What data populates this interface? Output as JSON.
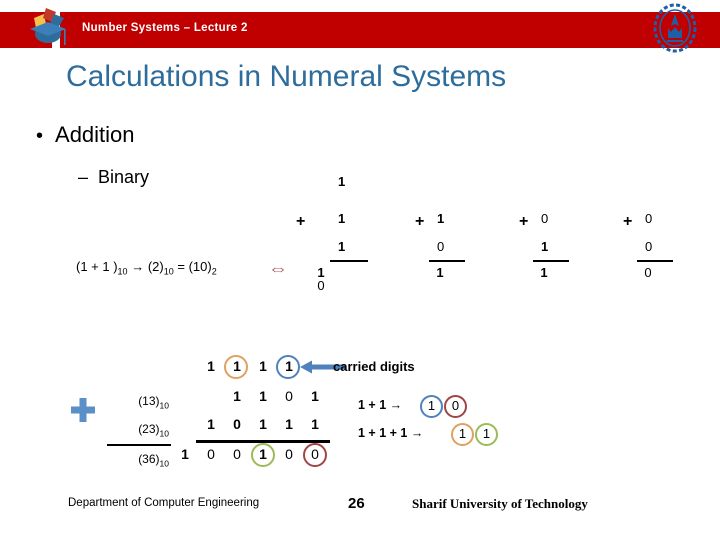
{
  "header": {
    "title": "Number Systems – Lecture 2",
    "bar_color": "#C00000",
    "left_logo": "graduation-cap-logo",
    "right_logo": "sharif-university-seal"
  },
  "slide": {
    "title": "Calculations in Numeral Systems",
    "title_color": "#2E6D9B",
    "bullet_level1": "Addition",
    "bullet_level1_marker": "•",
    "bullet_level2": "Binary",
    "bullet_level2_marker": "–"
  },
  "mini_sums": [
    {
      "carry": "1",
      "plus": "+",
      "operand_a": "1",
      "operand_b": "1",
      "result_digits": [
        "1",
        "0"
      ]
    },
    {
      "carry": "",
      "plus": "+",
      "operand_a": "1",
      "operand_b": "0",
      "result_digits": [
        "1"
      ]
    },
    {
      "carry": "",
      "plus": "+",
      "operand_a": "0",
      "operand_b": "1",
      "result_digits": [
        "1"
      ]
    },
    {
      "carry": "",
      "plus": "+",
      "operand_a": "0",
      "operand_b": "0",
      "result_digits": [
        "0"
      ]
    }
  ],
  "equation": {
    "text_a": "(1 + 1 )",
    "sub_a": "10",
    "arrow": "→",
    "text_b": "(2)",
    "sub_b": "10",
    "equals": "=",
    "text_c": "(10)",
    "sub_c": "2",
    "double_arrow": "⇔",
    "double_arrow_color": "#A85B5B"
  },
  "big_addition": {
    "plus_icon": "blue-plus-icon",
    "plus_color": "#5B8FC7",
    "labels": {
      "operand_a": "(13)",
      "operand_a_sub": "10",
      "operand_b": "(23)",
      "operand_b_sub": "10",
      "result": "(36)",
      "result_sub": "10"
    },
    "carry_row": [
      "",
      "1",
      "1",
      "1",
      "1",
      ""
    ],
    "operand_a_row": [
      "",
      "",
      "1",
      "1",
      "0",
      "1"
    ],
    "operand_b_row": [
      "",
      "1",
      "0",
      "1",
      "1",
      "1"
    ],
    "result_row": [
      "1",
      "0",
      "0",
      "1",
      "0",
      "0"
    ],
    "carry_circles": {
      "1": "#E0A060",
      "3": "#4F81BD"
    },
    "result_circles": {
      "3": "#9BBB59",
      "5": "#A04545"
    },
    "arrow": "left-arrow-icon",
    "arrow_color": "#4F81BD",
    "arrow_label": "carried digits"
  },
  "notes": [
    {
      "text": "1 + 1",
      "arrow": "→",
      "digits": [
        {
          "value": "1",
          "color": "#4F81BD"
        },
        {
          "value": "0",
          "color": "#A04545"
        }
      ]
    },
    {
      "text": "1 + 1 + 1",
      "arrow": "→",
      "digits": [
        {
          "value": "1",
          "color": "#E0A060"
        },
        {
          "value": "1",
          "color": "#9BBB59"
        }
      ]
    }
  ],
  "footer": {
    "left": "Department of Computer Engineering",
    "page_number": "26",
    "right": "Sharif University of Technology"
  }
}
